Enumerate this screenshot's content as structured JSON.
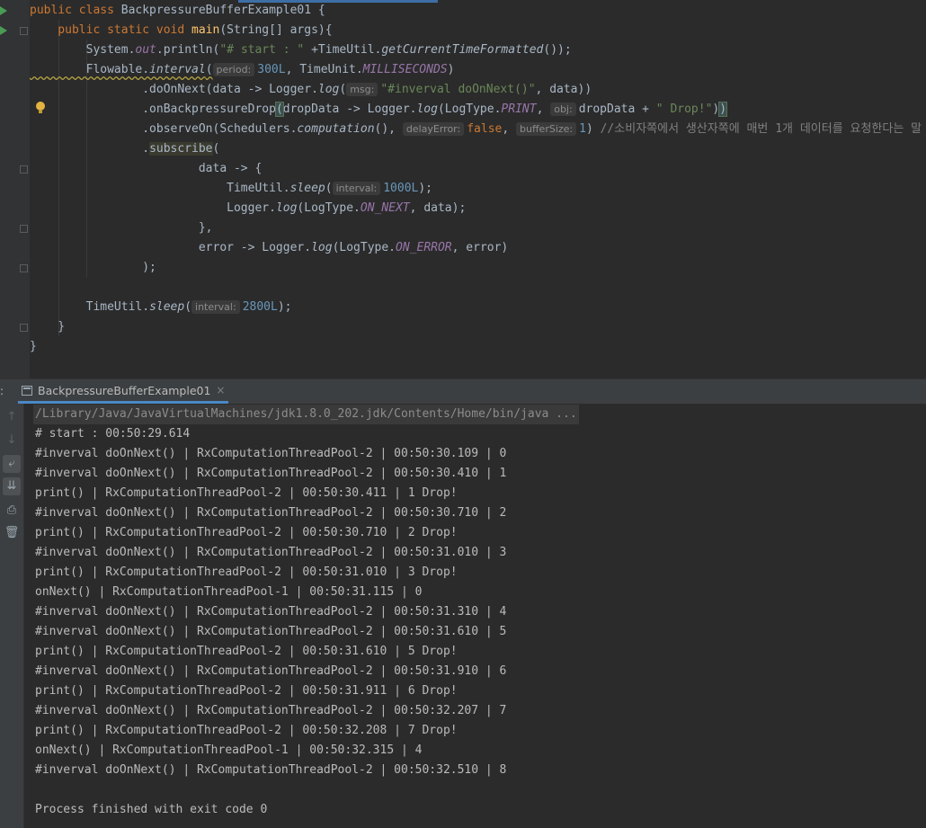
{
  "editor": {
    "lines": [
      {
        "segments": [
          [
            "kw",
            "public class "
          ],
          [
            "",
            "BackpressureBufferExample01 {"
          ]
        ]
      },
      {
        "segments": [
          [
            "kw",
            "    public static void "
          ],
          [
            "fn",
            "main"
          ],
          [
            "",
            "(String[] args){"
          ]
        ]
      },
      {
        "segments": [
          [
            "",
            "        System."
          ],
          [
            "st",
            "out"
          ],
          [
            "",
            ".println("
          ],
          [
            "str",
            "\"# start : \""
          ],
          [
            "",
            " +TimeUtil."
          ],
          [
            "it",
            "getCurrentTimeFormatted"
          ],
          [
            "",
            "());"
          ]
        ]
      },
      {
        "segments": [
          [
            "squiggle",
            "        Flowable."
          ],
          [
            "it squiggle",
            "interval"
          ],
          [
            "squiggle",
            "("
          ],
          [
            "hint",
            "period:"
          ],
          [
            "num",
            "300L"
          ],
          [
            "",
            ", TimeUnit."
          ],
          [
            "st",
            "MILLISECONDS"
          ],
          [
            "",
            ")"
          ]
        ]
      },
      {
        "segments": [
          [
            "",
            "                .doOnNext(data -> Logger."
          ],
          [
            "it",
            "log"
          ],
          [
            "",
            "("
          ],
          [
            "hint",
            "msg:"
          ],
          [
            "str",
            "\"#inverval doOnNext()\""
          ],
          [
            "",
            ", data))"
          ]
        ]
      },
      {
        "segments": [
          [
            "",
            "                .onBackpressureDrop"
          ],
          [
            "bracket-hl",
            "("
          ],
          [
            "",
            "dropData -> Logger."
          ],
          [
            "it",
            "log"
          ],
          [
            "",
            "(LogType."
          ],
          [
            "st",
            "PRINT"
          ],
          [
            "",
            ", "
          ],
          [
            "hint",
            "obj:"
          ],
          [
            "",
            "dropData + "
          ],
          [
            "str",
            "\" Drop!\""
          ],
          [
            "",
            ")"
          ],
          [
            "bracket-hl",
            ")"
          ]
        ]
      },
      {
        "segments": [
          [
            "",
            "                .observeOn(Schedulers."
          ],
          [
            "it",
            "computation"
          ],
          [
            "",
            "(), "
          ],
          [
            "hint",
            "delayError:"
          ],
          [
            "kw",
            "false"
          ],
          [
            "",
            ", "
          ],
          [
            "hint",
            "bufferSize:"
          ],
          [
            "num",
            "1"
          ],
          [
            "",
            ") "
          ],
          [
            "cmt",
            "//소비자쪽에서 생산자쪽에 매번 1개 데이터를 요청한다는 말"
          ]
        ]
      },
      {
        "segments": [
          [
            "",
            "                ."
          ],
          [
            "subscribe-hl",
            "subscribe"
          ],
          [
            "",
            "("
          ]
        ]
      },
      {
        "segments": [
          [
            "",
            "                        data -> {"
          ]
        ]
      },
      {
        "segments": [
          [
            "",
            "                            TimeUtil."
          ],
          [
            "it",
            "sleep"
          ],
          [
            "",
            "("
          ],
          [
            "hint",
            "interval:"
          ],
          [
            "num",
            "1000L"
          ],
          [
            "",
            ");"
          ]
        ]
      },
      {
        "segments": [
          [
            "",
            "                            Logger."
          ],
          [
            "it",
            "log"
          ],
          [
            "",
            "(LogType."
          ],
          [
            "st",
            "ON_NEXT"
          ],
          [
            "",
            ", data);"
          ]
        ]
      },
      {
        "segments": [
          [
            "",
            "                        },"
          ]
        ]
      },
      {
        "segments": [
          [
            "",
            "                        error -> Logger."
          ],
          [
            "it",
            "log"
          ],
          [
            "",
            "(LogType."
          ],
          [
            "st",
            "ON_ERROR"
          ],
          [
            "",
            ", error)"
          ]
        ]
      },
      {
        "segments": [
          [
            "",
            "                );"
          ]
        ]
      },
      {
        "segments": [
          [
            "",
            ""
          ]
        ]
      },
      {
        "segments": [
          [
            "",
            "        TimeUtil."
          ],
          [
            "it",
            "sleep"
          ],
          [
            "",
            "("
          ],
          [
            "hint",
            "interval:"
          ],
          [
            "num",
            "2800L"
          ],
          [
            "",
            ");"
          ]
        ]
      },
      {
        "segments": [
          [
            "",
            "    }"
          ]
        ]
      },
      {
        "segments": [
          [
            "",
            "}"
          ]
        ]
      }
    ]
  },
  "run_panel": {
    "tab_label": "BackpressureBufferExample01",
    "close_glyph": "×",
    "left_mark": ":",
    "toolbar_icons": [
      "up-arrow-icon",
      "down-arrow-icon",
      "soft-wrap-icon",
      "scroll-to-end-icon",
      "print-icon",
      "trash-icon"
    ],
    "console_lines": [
      "/Library/Java/JavaVirtualMachines/jdk1.8.0_202.jdk/Contents/Home/bin/java ...",
      "# start : 00:50:29.614",
      "#inverval doOnNext() | RxComputationThreadPool-2 | 00:50:30.109 | 0",
      "#inverval doOnNext() | RxComputationThreadPool-2 | 00:50:30.410 | 1",
      "print() | RxComputationThreadPool-2 | 00:50:30.411 | 1 Drop!",
      "#inverval doOnNext() | RxComputationThreadPool-2 | 00:50:30.710 | 2",
      "print() | RxComputationThreadPool-2 | 00:50:30.710 | 2 Drop!",
      "#inverval doOnNext() | RxComputationThreadPool-2 | 00:50:31.010 | 3",
      "print() | RxComputationThreadPool-2 | 00:50:31.010 | 3 Drop!",
      "onNext() | RxComputationThreadPool-1 | 00:50:31.115 | 0",
      "#inverval doOnNext() | RxComputationThreadPool-2 | 00:50:31.310 | 4",
      "#inverval doOnNext() | RxComputationThreadPool-2 | 00:50:31.610 | 5",
      "print() | RxComputationThreadPool-2 | 00:50:31.610 | 5 Drop!",
      "#inverval doOnNext() | RxComputationThreadPool-2 | 00:50:31.910 | 6",
      "print() | RxComputationThreadPool-2 | 00:50:31.911 | 6 Drop!",
      "#inverval doOnNext() | RxComputationThreadPool-2 | 00:50:32.207 | 7",
      "print() | RxComputationThreadPool-2 | 00:50:32.208 | 7 Drop!",
      "onNext() | RxComputationThreadPool-1 | 00:50:32.315 | 4",
      "#inverval doOnNext() | RxComputationThreadPool-2 | 00:50:32.510 | 8",
      "",
      "Process finished with exit code 0"
    ]
  },
  "colors": {
    "editor_bg": "#2b2b2b",
    "keyword": "#cc7832",
    "method_decl": "#ffc66d",
    "string": "#6a8759",
    "number": "#6897bb",
    "static_field": "#9876aa",
    "run_icon": "#499c54",
    "tab_underline": "#4a88c7"
  }
}
